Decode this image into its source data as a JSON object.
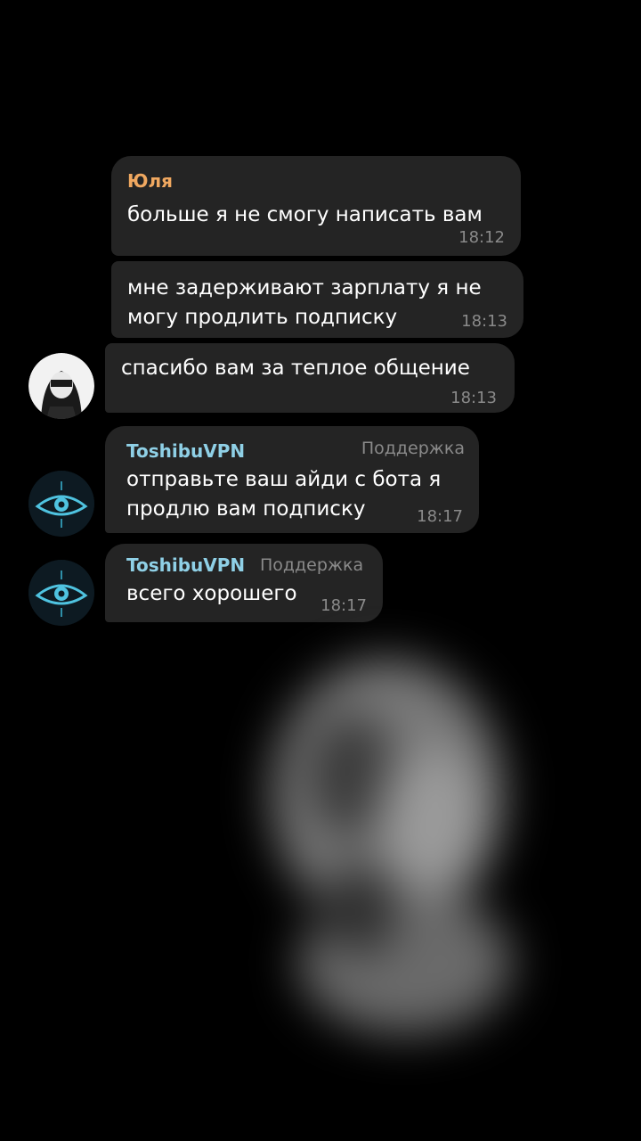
{
  "messages": [
    {
      "sender": "Юля",
      "text": "больше я не смогу написать вам",
      "time": "18:12"
    },
    {
      "text": "мне задерживают зарплату я не\nмогу продлить подписку",
      "time": "18:13"
    },
    {
      "text": "спасибо вам за теплое общение",
      "time": "18:13"
    },
    {
      "sender": "ToshibuVPN",
      "role": "Поддержка",
      "text": "отправьте ваш айди с бота я\nпродлю вам подписку",
      "time": "18:17"
    },
    {
      "sender": "ToshibuVPN",
      "role": "Поддержка",
      "text": "всего хорошего",
      "time": "18:17"
    }
  ],
  "colors": {
    "background": "#000000",
    "bubble": "#242424",
    "yulia_name": "#f0a860",
    "vpn_name": "#8fd0e6",
    "meta": "#8a8a8a"
  },
  "icons": {
    "user_avatar": "anime-girl-avatar",
    "bot_avatar": "eye-emblem-avatar"
  }
}
